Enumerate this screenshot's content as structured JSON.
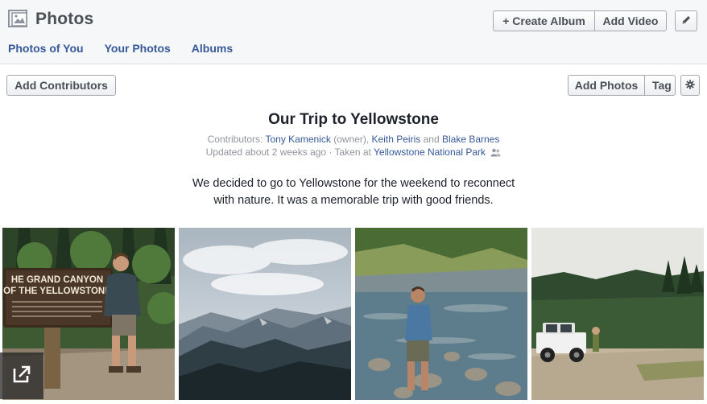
{
  "header": {
    "title": "Photos",
    "create_album": "+ Create Album",
    "add_video": "Add Video",
    "edit_icon": "pencil-icon"
  },
  "tabs": [
    "Photos of You",
    "Your Photos",
    "Albums"
  ],
  "toolbar": {
    "add_contributors": "Add Contributors",
    "add_photos": "Add Photos",
    "tag": "Tag",
    "settings_icon": "gear-icon"
  },
  "album": {
    "title": "Our Trip to Yellowstone",
    "contributors_label": "Contributors:",
    "contributors": [
      {
        "name": "Tony Kamenick",
        "note": "(owner),"
      },
      {
        "name": "Keith Peiris",
        "note": "and"
      },
      {
        "name": "Blake Barnes",
        "note": ""
      }
    ],
    "updated_text": "Updated about 2 weeks ago · Taken at",
    "location": "Yellowstone National Park",
    "audience_icon": "friends-icon",
    "description_line1": "We decided to go to Yellowstone for the weekend to reconnect",
    "description_line2": "with nature. It was a memorable trip with good friends."
  },
  "photo_sign": {
    "line1": "HE GRAND CANYON",
    "line2": "OF THE YELLOWSTONE"
  },
  "colors": {
    "link": "#365899",
    "header_bg": "#f6f7f9",
    "text": "#1d2129"
  }
}
